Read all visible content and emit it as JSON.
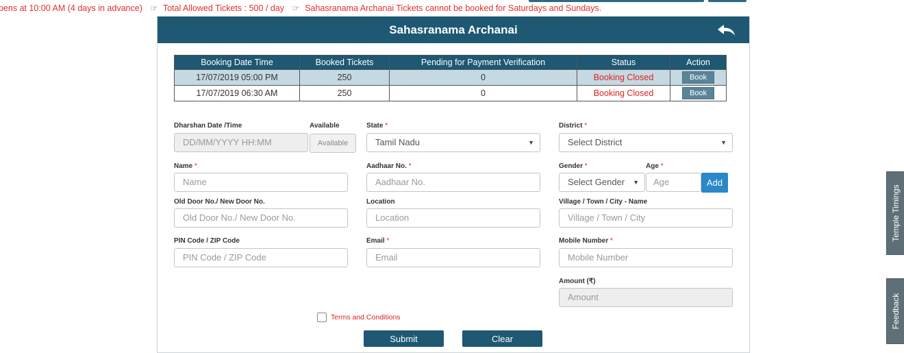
{
  "notice": {
    "part1": "pens at 10:00 AM (4 days in advance)",
    "part2": "Total Allowed Tickets : 500 / day",
    "part3": "Sahasranama Archanai Tickets cannot be booked for Saturdays and Sundays.",
    "hand_glyph": "☞",
    "color": "#e03030"
  },
  "panel": {
    "title": "Sahasranama Archanai",
    "back_icon": "back-arrow-icon",
    "header_color": "#1e5873"
  },
  "table": {
    "headers": [
      "Booking Date Time",
      "Booked Tickets",
      "Pending for Payment Verification",
      "Status",
      "Action"
    ],
    "rows": [
      {
        "datetime": "17/07/2019 05:00 PM",
        "booked": "250",
        "pending": "0",
        "status": "Booking Closed",
        "action": "Book",
        "selected": true
      },
      {
        "datetime": "17/07/2019 06:30 AM",
        "booked": "250",
        "pending": "0",
        "status": "Booking Closed",
        "action": "Book",
        "selected": false
      }
    ]
  },
  "form": {
    "required_mark": "*",
    "dharshan": {
      "label": "Dharshan Date /Time",
      "placeholder": "DD/MM/YYYY HH:MM"
    },
    "available": {
      "label": "Available",
      "button": "Available"
    },
    "state": {
      "label": "State",
      "value": "Tamil Nadu"
    },
    "district": {
      "label": "District",
      "value": "Select District"
    },
    "name": {
      "label": "Name",
      "placeholder": "Name"
    },
    "aadhaar": {
      "label": "Aadhaar No.",
      "placeholder": "Aadhaar No."
    },
    "gender": {
      "label": "Gender",
      "value": "Select Gender"
    },
    "age": {
      "label": "Age",
      "placeholder": "Age"
    },
    "add_button": "Add",
    "door": {
      "label": "Old Door No./ New Door No.",
      "placeholder": "Old Door No./ New Door No."
    },
    "location": {
      "label": "Location",
      "placeholder": "Location"
    },
    "village": {
      "label": "Village / Town / City - Name",
      "placeholder": "Village / Town / City"
    },
    "pin": {
      "label": "PIN Code / ZIP Code",
      "placeholder": "PIN Code / ZIP Code"
    },
    "email": {
      "label": "Email",
      "placeholder": "Email"
    },
    "mobile": {
      "label": "Mobile Number",
      "placeholder": "Mobile Number"
    },
    "amount": {
      "label": "Amount (₹)",
      "placeholder": "Amount"
    },
    "terms": "Terms and Conditions",
    "submit": "Submit",
    "clear": "Clear"
  },
  "side_tabs": {
    "temple_timings": "Temple Timings",
    "feedback": "Feedback"
  }
}
